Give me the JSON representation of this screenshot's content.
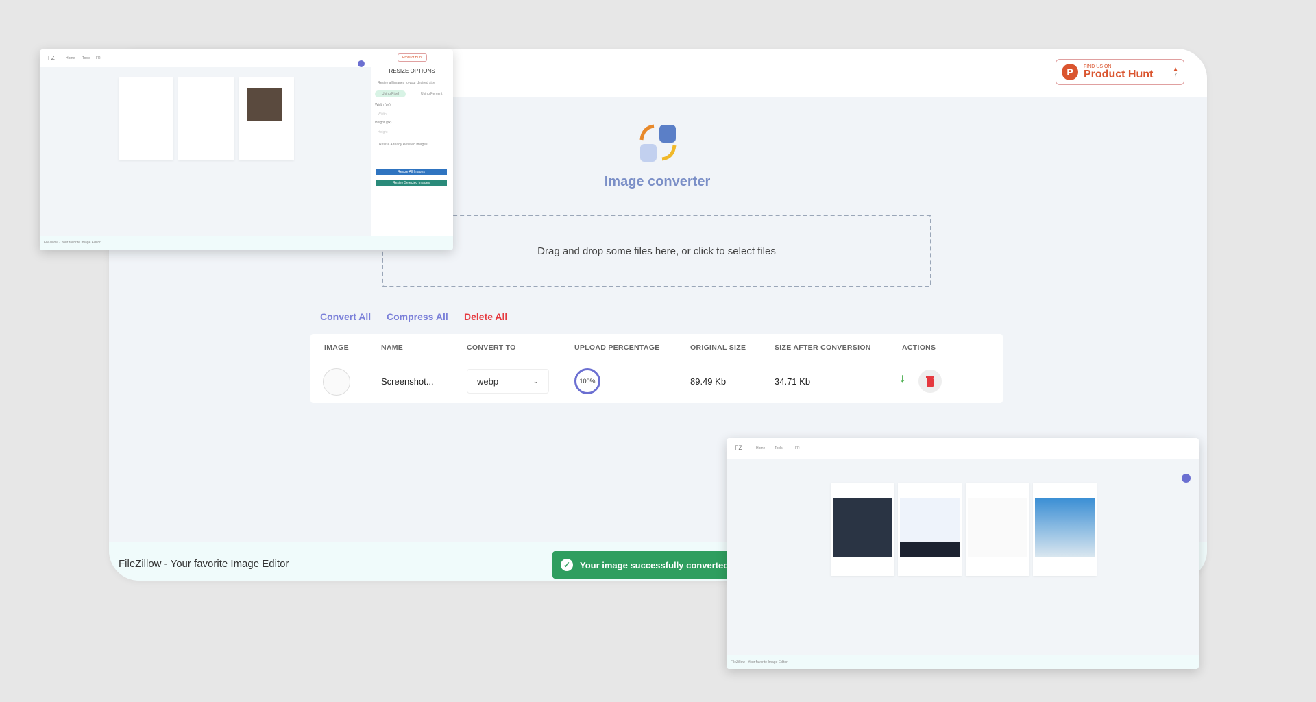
{
  "header": {
    "badge_small": "Find us on",
    "badge_label": "Product Hunt",
    "badge_count": "7",
    "badge_color": "#da552f"
  },
  "app": {
    "title": "Image converter",
    "logo_icon": "converter-logo-icon"
  },
  "dropzone": {
    "text": "Drag and drop some files here, or click to select files"
  },
  "actions": {
    "convert_all": "Convert All",
    "compress_all": "Compress All",
    "delete_all": "Delete All"
  },
  "table": {
    "columns": [
      "IMAGE",
      "NAME",
      "CONVERT TO",
      "UPLOAD PERCENTAGE",
      "ORIGINAL SIZE",
      "SIZE AFTER CONVERSION",
      "ACTIONS"
    ],
    "rows": [
      {
        "name": "Screenshot...",
        "convert_to": "webp",
        "upload_percentage": "100%",
        "original_size": "89.49 Kb",
        "size_after": "34.71 Kb"
      }
    ]
  },
  "footer": {
    "text": "FileZillow - Your favorite Image Editor"
  },
  "toast": {
    "text": "Your image successfully converted",
    "status_color": "#2f9e5f"
  },
  "overlay_resize": {
    "nav": [
      "Home",
      "Tools",
      "FR"
    ],
    "badge": "Product Hunt",
    "panel_title": "RESIZE OPTIONS",
    "panel_sub": "Resize all images to your desired size",
    "tab_pixel": "Using Pixel",
    "tab_percent": "Using Percent",
    "width_label": "Width (px)",
    "height_label": "Height (px)",
    "width_placeholder": "Width",
    "height_placeholder": "Height",
    "resize_already": "Resize Already Resized Images",
    "resize_all": "Resize All Images",
    "resize_selected": "Resize Selected Images",
    "footer": "FileZillow - Your favorite Image Editor"
  },
  "overlay_rotate": {
    "nav": [
      "Home",
      "Tools",
      "FR"
    ],
    "footer": "FileZillow - Your favorite Image Editor"
  }
}
